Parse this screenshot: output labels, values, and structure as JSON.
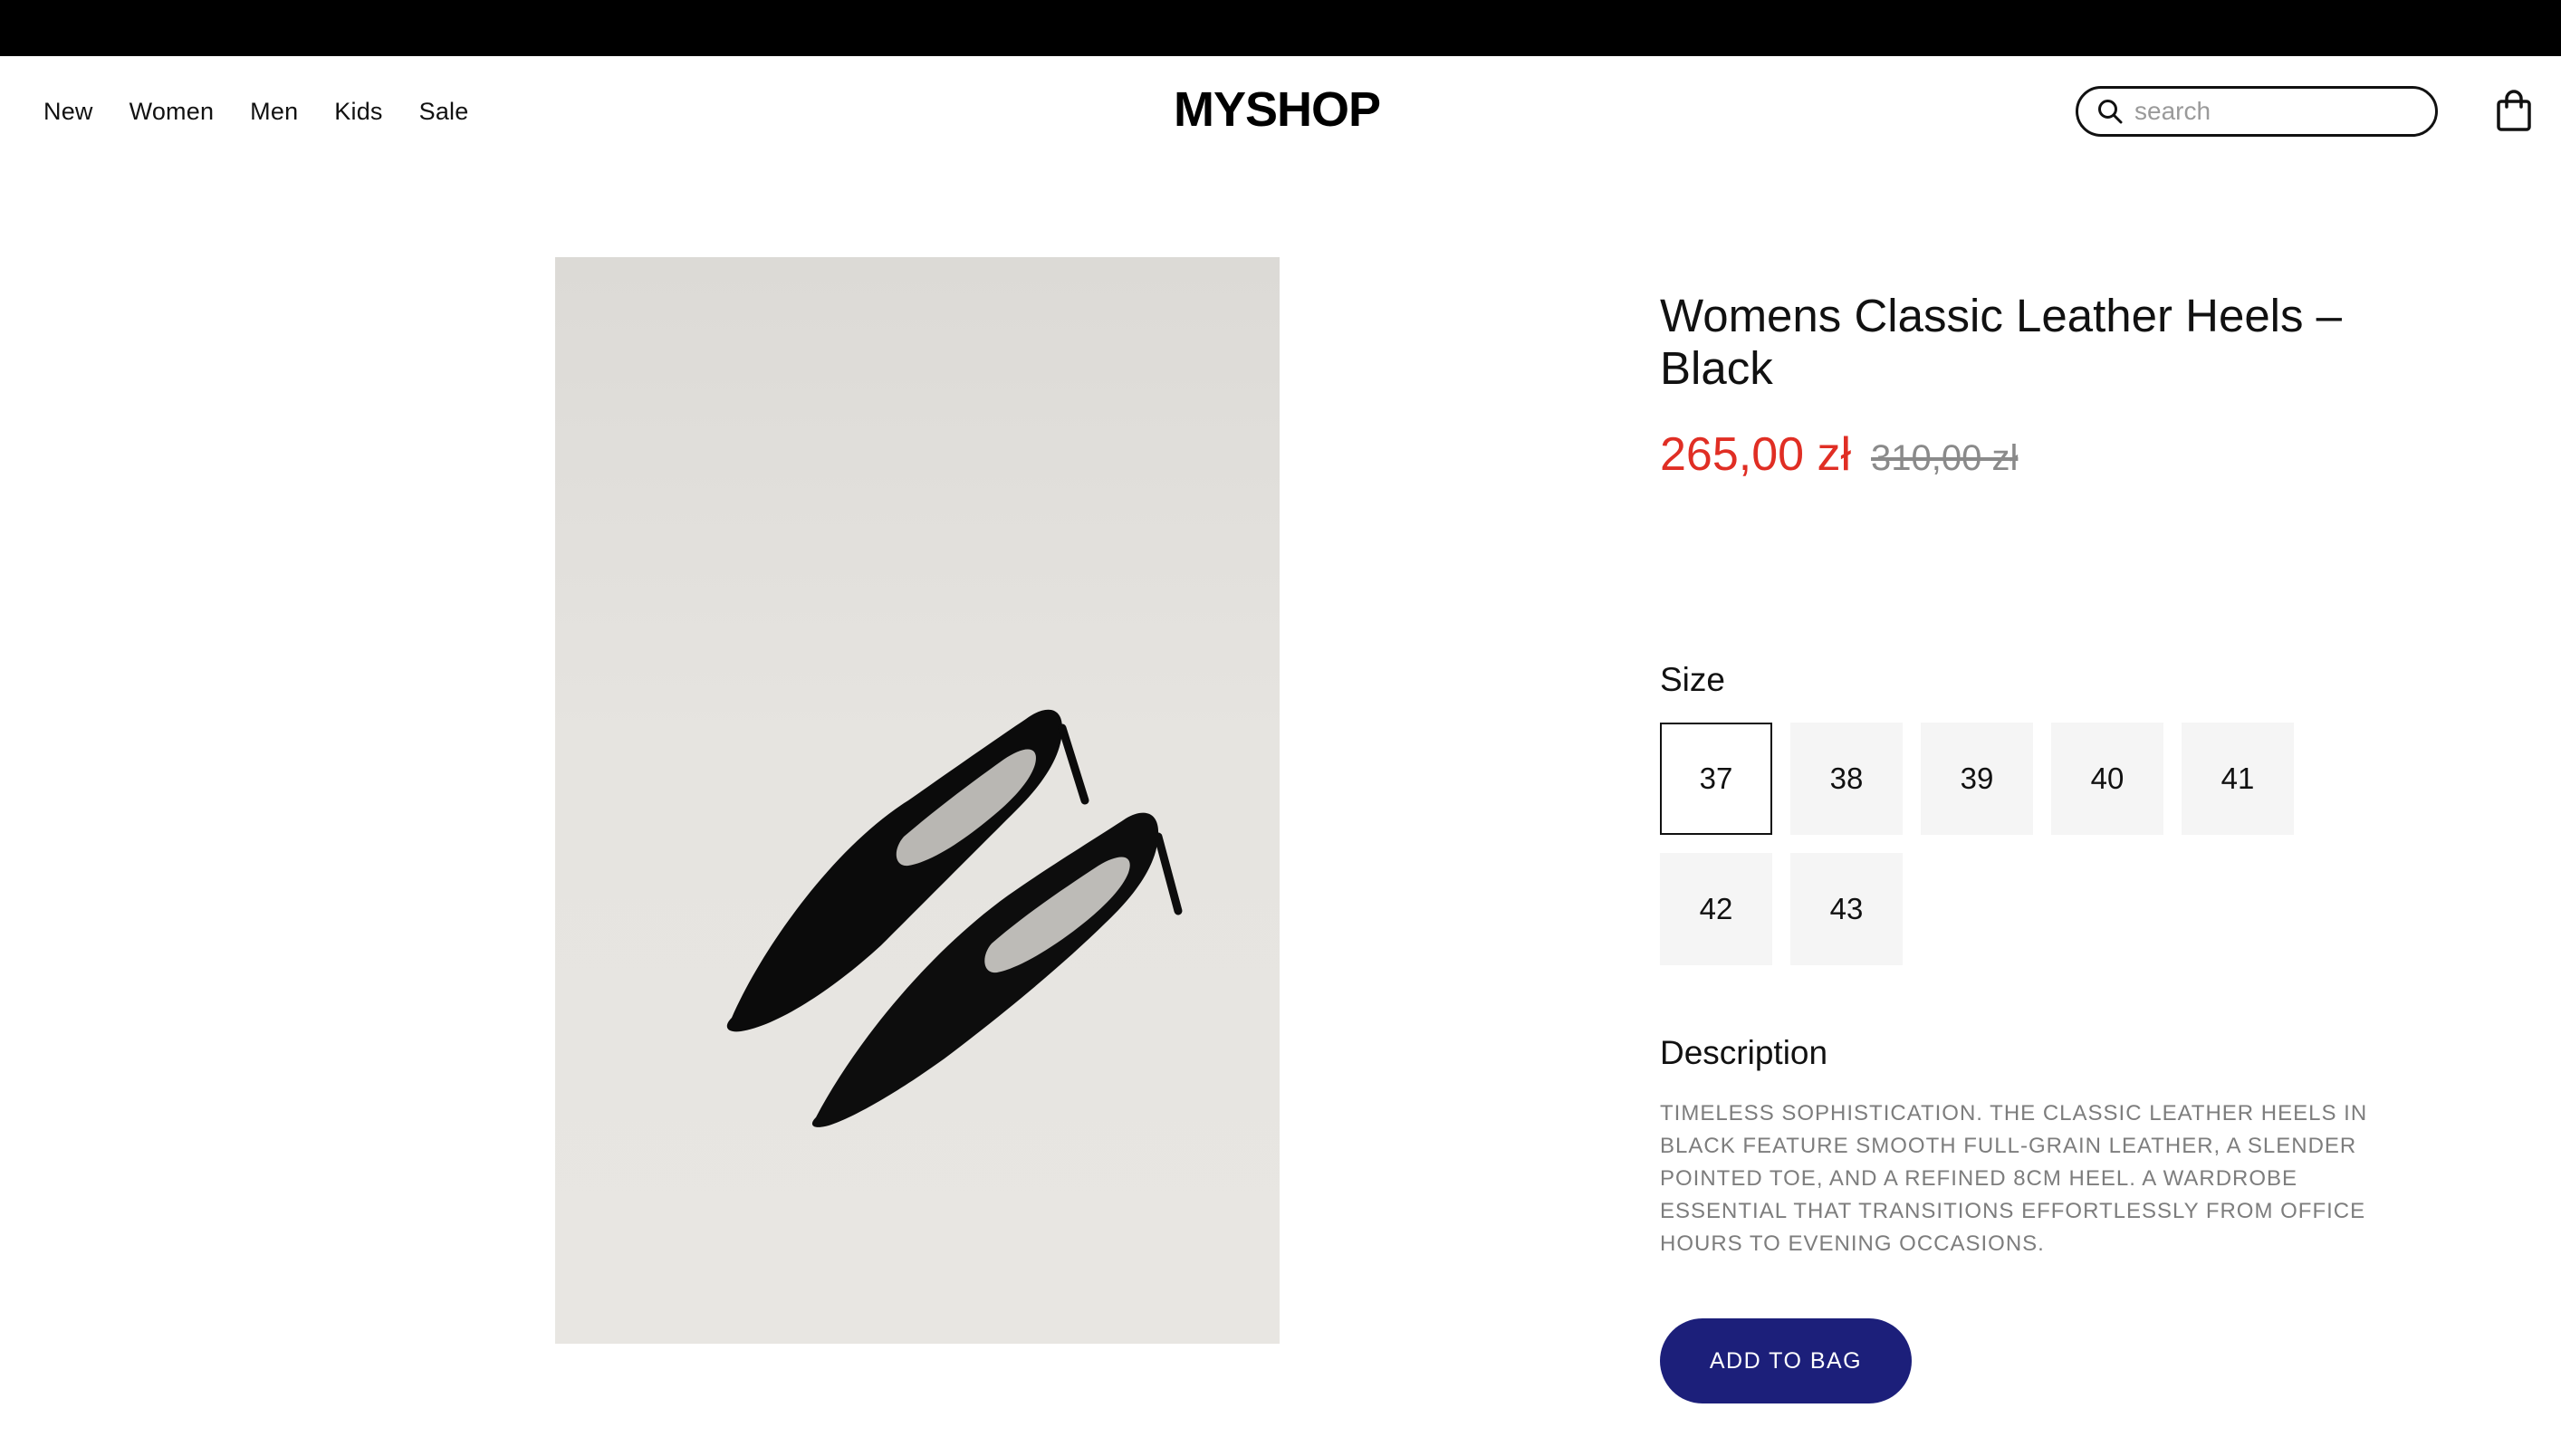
{
  "header": {
    "nav": [
      "New",
      "Women",
      "Men",
      "Kids",
      "Sale"
    ],
    "logo": "MYSHOP",
    "search_placeholder": "search"
  },
  "icons": {
    "search": "search-icon",
    "bag": "shopping-bag-icon"
  },
  "product": {
    "image_alt": "Black pointed-toe heels on light grey background",
    "title": "Womens Classic Leather Heels – Black",
    "price_current": "265,00 zł",
    "price_old": "310,00 zł",
    "size_label": "Size",
    "sizes": [
      "37",
      "38",
      "39",
      "40",
      "41",
      "42",
      "43"
    ],
    "selected_size": "37",
    "description_label": "Description",
    "description": "Timeless sophistication. The Classic Leather Heels in Black feature smooth full-grain leather, a slender pointed toe, and a refined 8cm heel. A wardrobe essential that transitions effortlessly from office hours to evening occasions.",
    "add_to_bag": "ADD TO BAG"
  },
  "colors": {
    "sale_price": "#e02e24",
    "old_price": "#8a8a8a",
    "button": "#1c1f7a",
    "topbar": "#000000"
  }
}
